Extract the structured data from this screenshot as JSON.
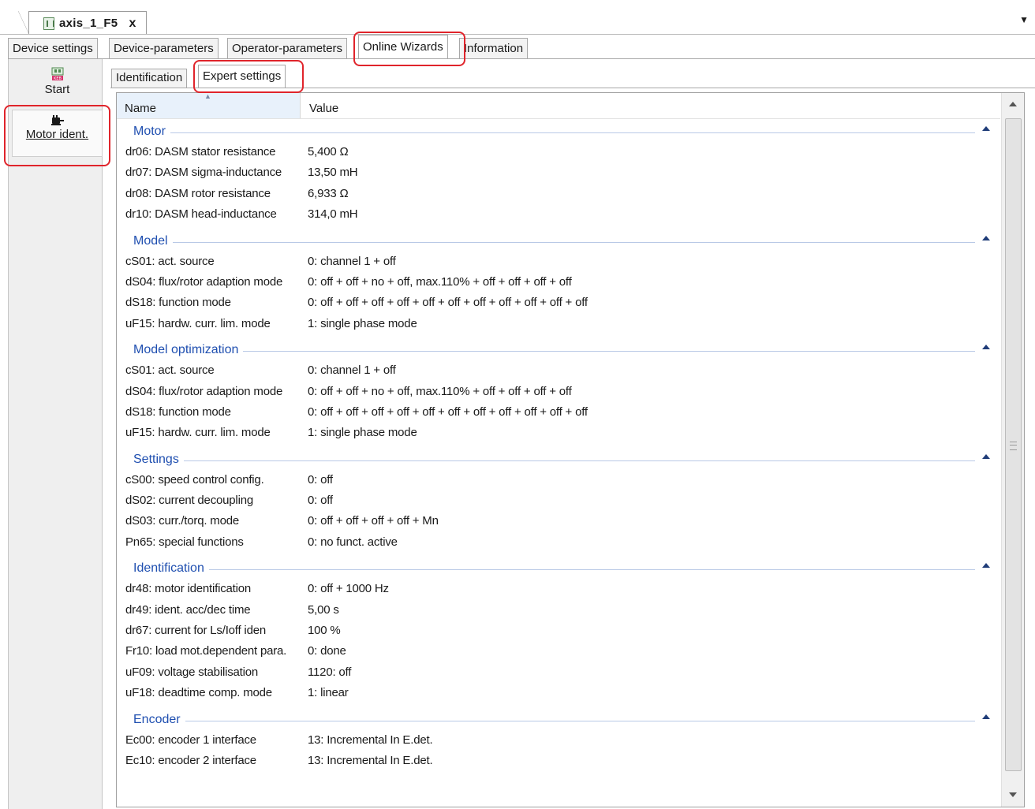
{
  "document": {
    "title": "axis_1_F5",
    "close_glyph": "x",
    "dropdown_glyph": "▼"
  },
  "main_tabs": [
    {
      "label": "Device settings"
    },
    {
      "label": "Device-parameters"
    },
    {
      "label": "Operator-parameters"
    },
    {
      "label": "Online Wizards",
      "active": true
    },
    {
      "label": "Information"
    }
  ],
  "wizards": [
    {
      "label": "Start",
      "icon": "keb-start-icon"
    },
    {
      "label": "Motor ident.",
      "icon": "motor-icon",
      "active": true
    }
  ],
  "sub_tabs": [
    {
      "label": "Identification"
    },
    {
      "label": "Expert settings",
      "active": true
    }
  ],
  "columns": {
    "name": "Name",
    "value": "Value"
  },
  "groups": [
    {
      "title": "Motor",
      "rows": [
        {
          "name": "dr06: DASM stator resistance",
          "value": "5,400 Ω"
        },
        {
          "name": "dr07: DASM sigma-inductance",
          "value": "13,50 mH"
        },
        {
          "name": "dr08: DASM rotor resistance",
          "value": "6,933 Ω"
        },
        {
          "name": "dr10: DASM head-inductance",
          "value": "314,0 mH"
        }
      ]
    },
    {
      "title": "Model",
      "rows": [
        {
          "name": "cS01: act. source",
          "value": "0: channel 1 + off"
        },
        {
          "name": "dS04: flux/rotor adaption mode",
          "value": "0: off + off + no + off, max.110% + off + off + off + off"
        },
        {
          "name": "dS18: function mode",
          "value": "0: off + off + off + off + off + off + off + off + off + off + off"
        },
        {
          "name": "uF15: hardw. curr. lim. mode",
          "value": "1: single phase mode"
        }
      ]
    },
    {
      "title": "Model optimization",
      "rows": [
        {
          "name": "cS01: act. source",
          "value": "0: channel 1 + off"
        },
        {
          "name": "dS04: flux/rotor adaption mode",
          "value": "0: off + off + no + off, max.110% + off + off + off + off"
        },
        {
          "name": "dS18: function mode",
          "value": "0: off + off + off + off + off + off + off + off + off + off + off"
        },
        {
          "name": "uF15: hardw. curr. lim. mode",
          "value": "1: single phase mode"
        }
      ]
    },
    {
      "title": "Settings",
      "rows": [
        {
          "name": "cS00: speed control config.",
          "value": "0: off"
        },
        {
          "name": "dS02: current decoupling",
          "value": "0: off"
        },
        {
          "name": "dS03: curr./torq. mode",
          "value": "0: off + off + off + off + Mn"
        },
        {
          "name": "Pn65: special functions",
          "value": "0: no funct. active"
        }
      ]
    },
    {
      "title": "Identification",
      "rows": [
        {
          "name": "dr48: motor identification",
          "value": "0: off + 1000 Hz"
        },
        {
          "name": "dr49: ident. acc/dec time",
          "value": "5,00 s"
        },
        {
          "name": "dr67: current for Ls/Ioff iden",
          "value": "100 %"
        },
        {
          "name": "Fr10: load mot.dependent para.",
          "value": "0: done"
        },
        {
          "name": "uF09: voltage stabilisation",
          "value": "1120: off"
        },
        {
          "name": "uF18: deadtime comp. mode",
          "value": "1: linear"
        }
      ]
    },
    {
      "title": "Encoder",
      "rows": [
        {
          "name": "Ec00: encoder 1 interface",
          "value": "13: Incremental In E.det."
        },
        {
          "name": "Ec10: encoder 2 interface",
          "value": "13: Incremental In E.det."
        }
      ]
    }
  ],
  "colors": {
    "accent": "#1f4fb0",
    "highlight": "#e0242b"
  }
}
